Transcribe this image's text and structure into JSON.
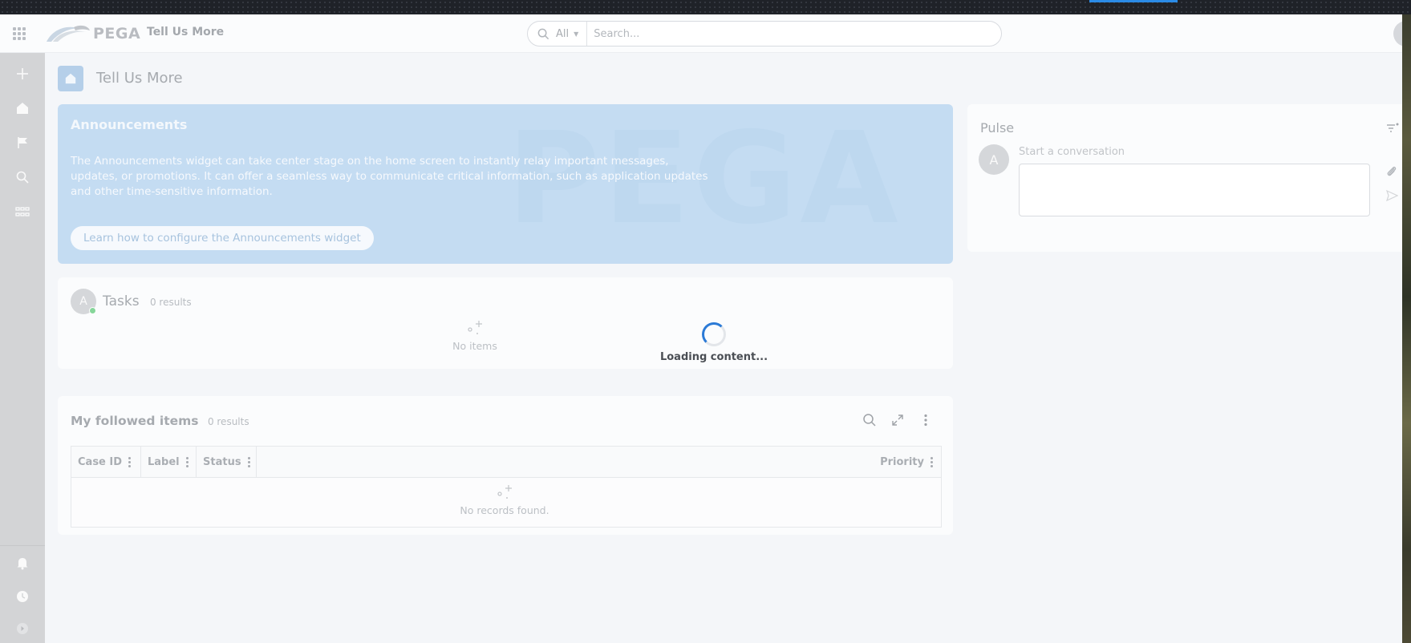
{
  "header": {
    "logo_text": "PEGA",
    "app_name": "Tell Us More",
    "search_scope": "All",
    "search_placeholder": "Search..."
  },
  "page": {
    "title": "Tell Us More"
  },
  "announcements": {
    "title": "Announcements",
    "body": "The Announcements widget can take center stage on the home screen to instantly relay important messages, updates, or promotions. It can offer a seamless way to communicate critical information, such as application updates and other time-sensitive information.",
    "link_label": "Learn how to configure the Announcements widget",
    "watermark": "PEGA"
  },
  "tasks": {
    "avatar": "A",
    "title": "Tasks",
    "count": "0 results",
    "empty": "No items"
  },
  "loading": {
    "text": "Loading content..."
  },
  "followed": {
    "title": "My followed items",
    "count": "0 results",
    "columns": [
      "Case ID",
      "Label",
      "Status",
      "Priority"
    ],
    "empty": "No records found."
  },
  "pulse": {
    "title": "Pulse",
    "avatar": "A",
    "placeholder": "Start a conversation"
  },
  "colors": {
    "accent": "#2b7ad6",
    "announcement_bg": "#c4dcf2",
    "online": "#86d69a"
  }
}
